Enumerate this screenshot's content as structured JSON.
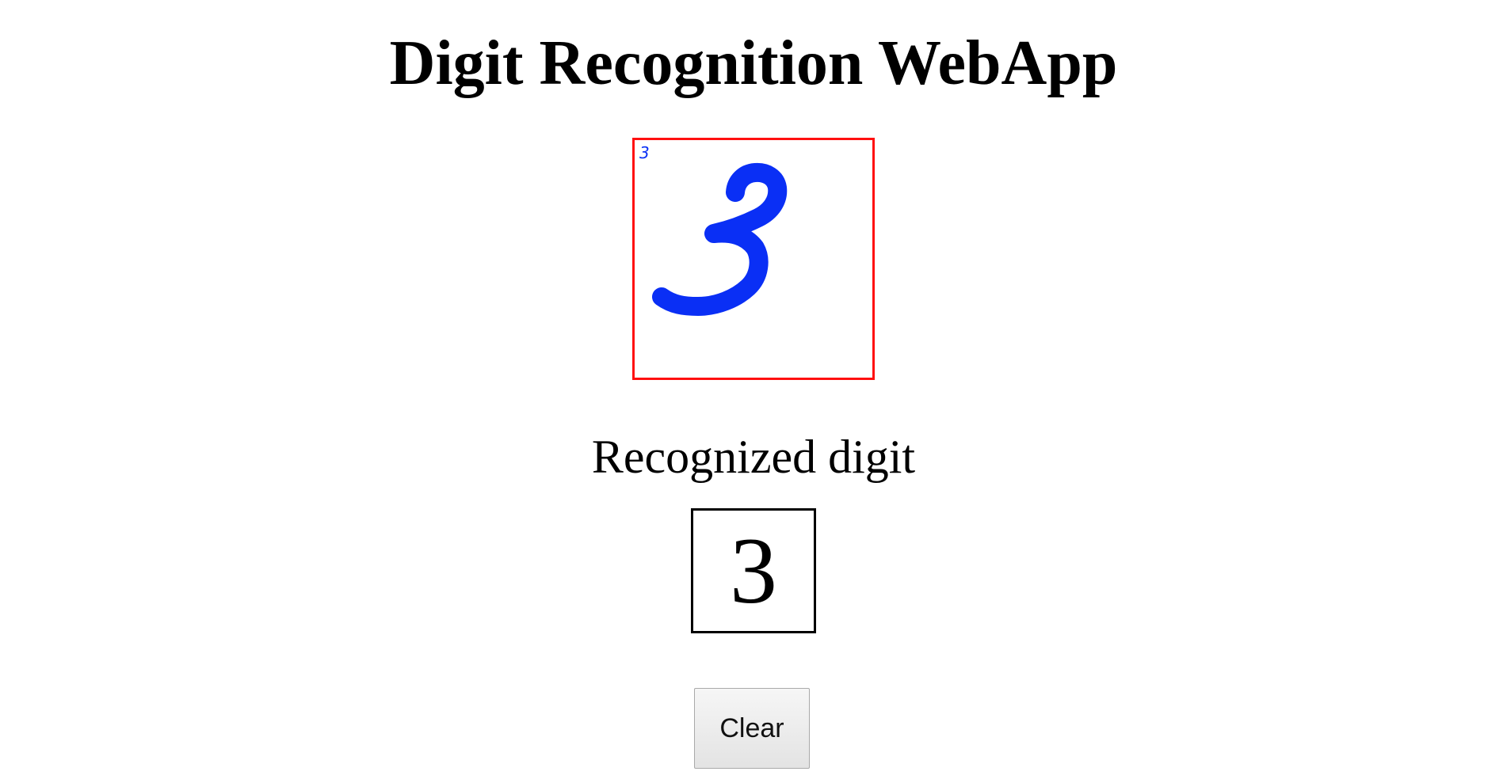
{
  "header": {
    "title": "Digit Recognition WebApp"
  },
  "canvas": {
    "border_color": "#ff1010",
    "stroke_color": "#0a2ff5",
    "thumbnail_label": "3"
  },
  "result": {
    "label": "Recognized digit",
    "digit": "3"
  },
  "actions": {
    "clear_label": "Clear"
  }
}
